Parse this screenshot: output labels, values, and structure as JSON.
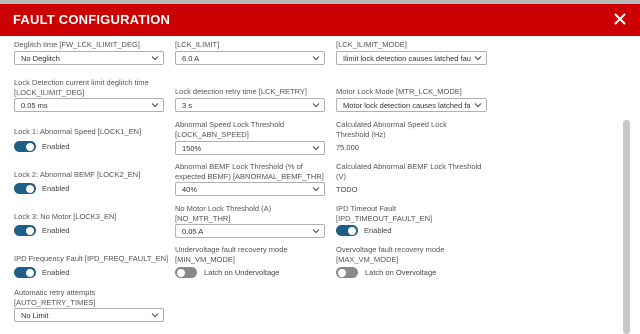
{
  "background": {
    "tab_snippets": [
      "...",
      "...",
      "...",
      "..."
    ]
  },
  "dialog": {
    "title": "FAULT CONFIGURATION",
    "close_icon": "close-icon",
    "header_color": "#cc0000"
  },
  "row0": {
    "c1": {
      "label": "Deglitch time [FW_LCK_ILIMIT_DEG]",
      "value": "No Deglitch"
    },
    "c2": {
      "label": "[LCK_ILIMIT]",
      "value": "6.0 A"
    },
    "c3": {
      "label": "[LCK_ILIMIT_MODE]",
      "value": "Ilimit lock detection causes latched fau"
    }
  },
  "row1": {
    "c1": {
      "label_line1": "Lock Detection current limit deglitch time",
      "label_line2": "[LOCK_ILIMIT_DEG]",
      "value": "0.05 ms"
    },
    "c2": {
      "label": "Lock detection retry time [LCK_RETRY]",
      "value": "3 s"
    },
    "c3": {
      "label": "Motor Lock Mode [MTR_LCK_MODE]",
      "value": "Motor lock detection causes latched fa"
    }
  },
  "row2": {
    "c1": {
      "label": "Lock 1: Abnormal Speed [LOCK1_EN]",
      "toggle": "Enabled",
      "on": true
    },
    "c2": {
      "label_line1": "Abnormal Speed Lock Threshold",
      "label_line2": "[LOCK_ABN_SPEED]",
      "value": "150%"
    },
    "c3": {
      "label_line1": "Calculated Abnormal Speed Lock",
      "label_line2": "Threshold (Hz)",
      "value": "75.000"
    }
  },
  "row3": {
    "c1": {
      "label": "Lock 2: Abnormal BEMF [LOCK2_EN]",
      "toggle": "Enabled",
      "on": true
    },
    "c2": {
      "label_line1": "Abnormal BEMF Lock Threshold (% of",
      "label_line2": "expected BEMF) [ABNORMAL_BEMF_THR]",
      "value": "40%"
    },
    "c3": {
      "label_line1": "Calculated Abnormal BEMF Lock Threshold",
      "label_line2": "(V)",
      "value": "TODO"
    }
  },
  "row4": {
    "c1": {
      "label": "Lock 3: No Motor [LOCK3_EN]",
      "toggle": "Enabled",
      "on": true
    },
    "c2": {
      "label_line1": "No Motor Lock Threshold (A)",
      "label_line2": "[NO_MTR_THR]",
      "value": "0.05 A"
    },
    "c3": {
      "label_line1": "IPD Timeout Fault",
      "label_line2": "[IPD_TIMEOUT_FAULT_EN]",
      "toggle": "Enabled",
      "on": true
    }
  },
  "row5": {
    "c1": {
      "label": "IPD Frequency Fault [IPD_FREQ_FAULT_EN]",
      "toggle": "Enabled",
      "on": true
    },
    "c2": {
      "label_line1": "Undervoltage fault recovery mode",
      "label_line2": "[MIN_VM_MODE]",
      "toggle": "Latch on Undervoltage",
      "on": false
    },
    "c3": {
      "label_line1": "Overvoltage fault recovery mode",
      "label_line2": "[MAX_VM_MODE]",
      "toggle": "Latch on Overvoltage",
      "on": false
    }
  },
  "row6": {
    "c1": {
      "label_line1": "Automatic retry attempts",
      "label_line2": "[AUTO_RETRY_TIMES]",
      "value": "No Limit"
    }
  },
  "colors": {
    "toggle_on": "#1f5e87",
    "toggle_off": "#8a8a8a"
  }
}
